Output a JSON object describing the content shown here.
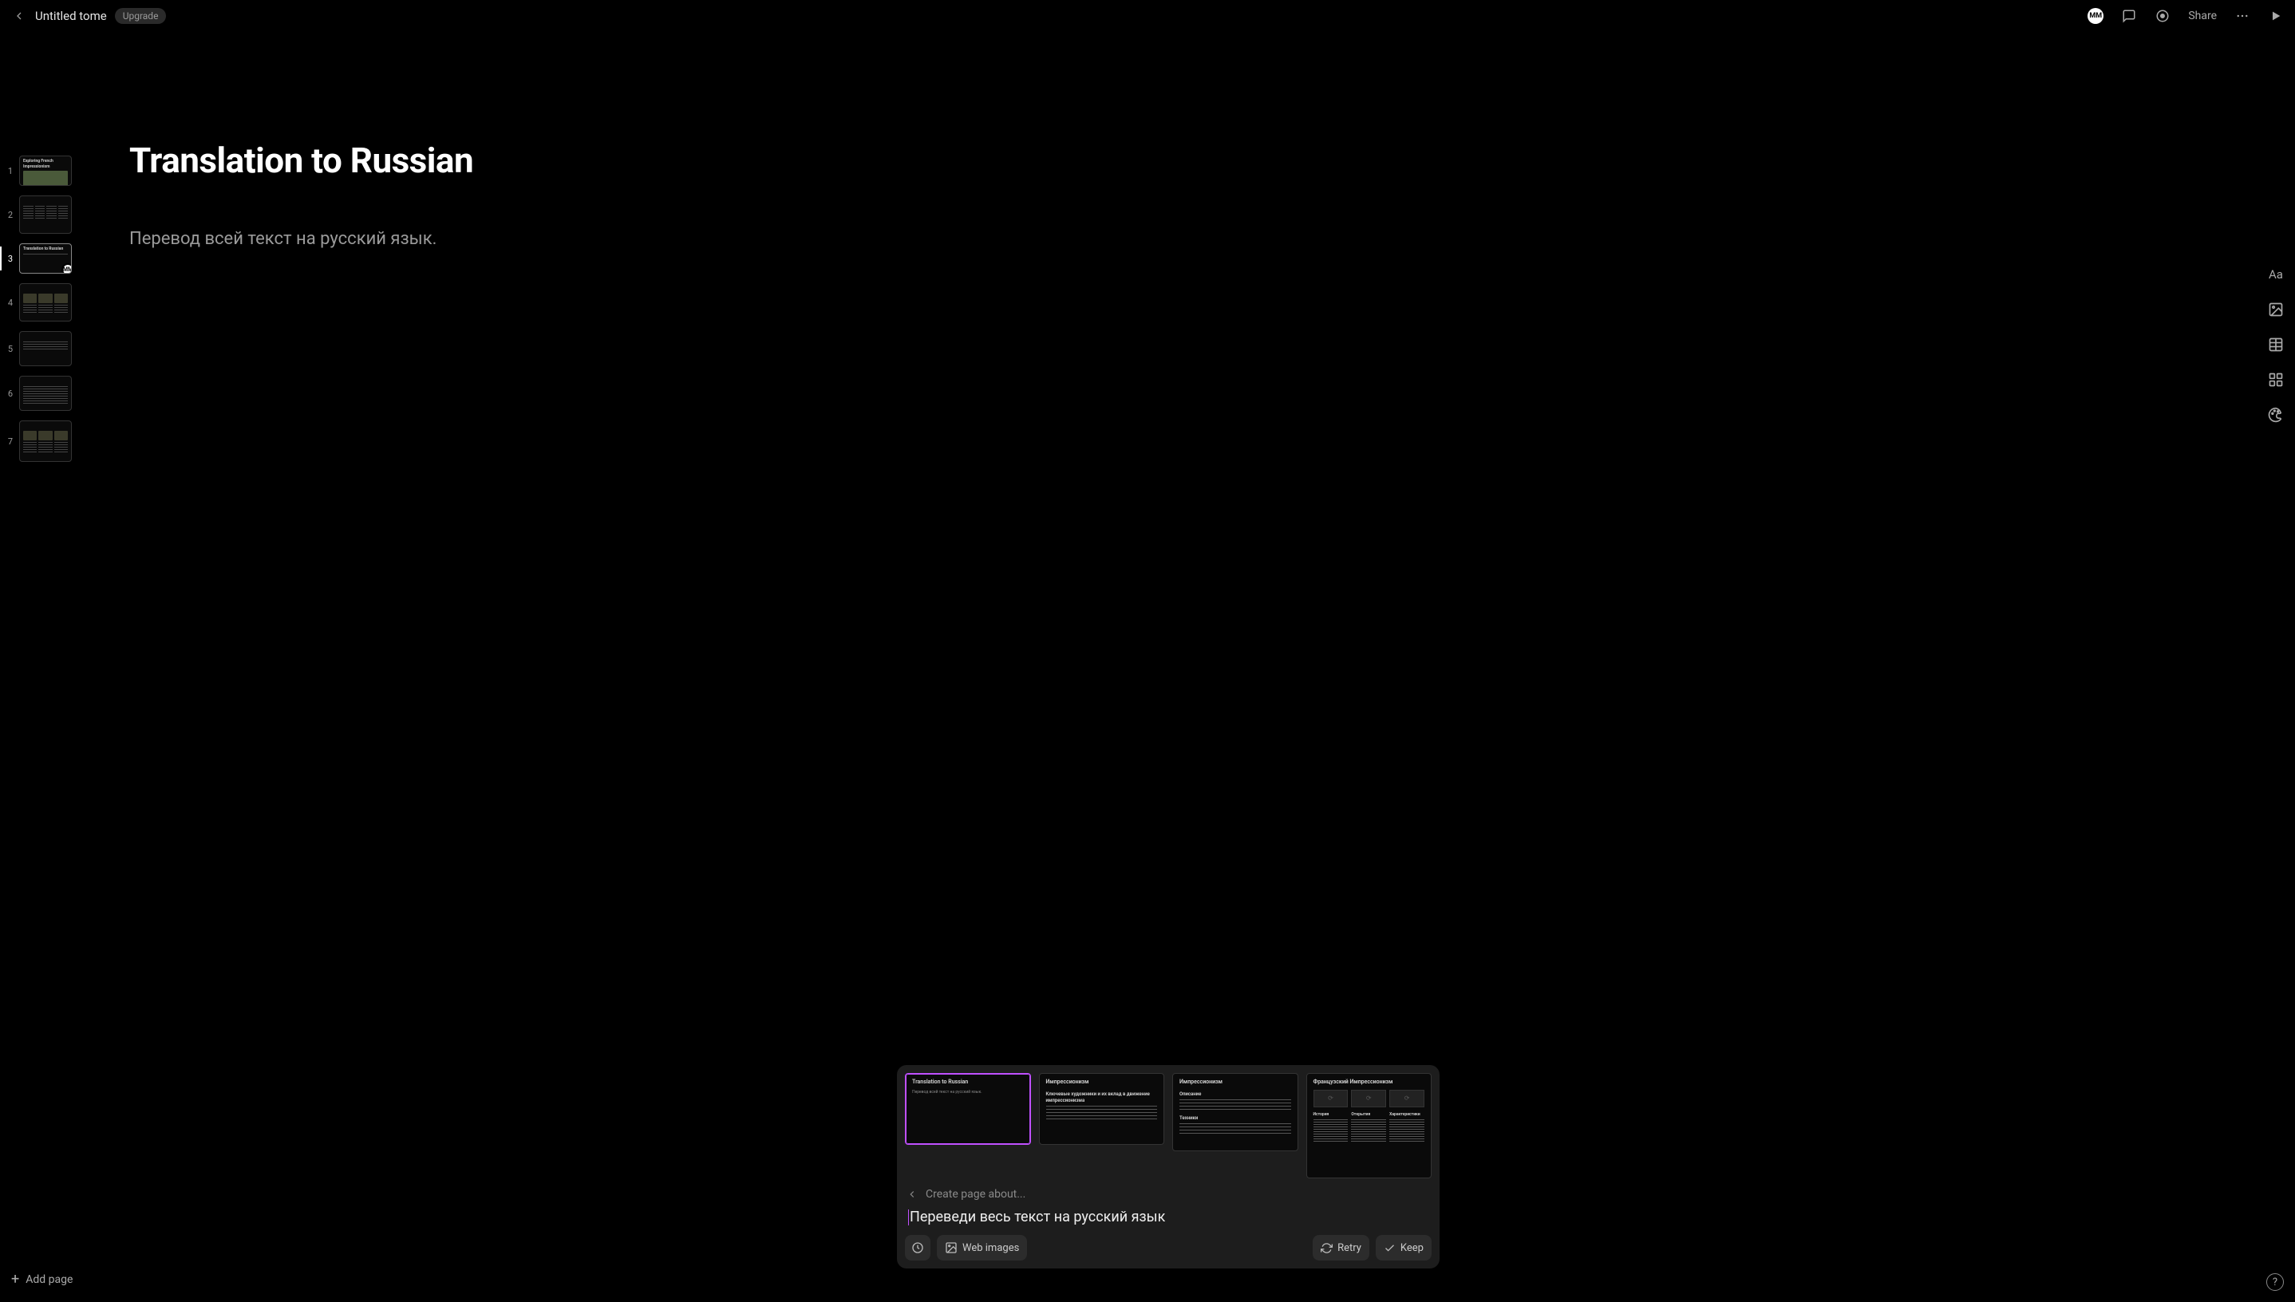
{
  "header": {
    "title": "Untitled tome",
    "upgrade": "Upgrade",
    "share": "Share",
    "avatar_initials": "MM"
  },
  "sidebar": {
    "thumbs": [
      {
        "num": "1",
        "title": "Exploring French Impressionism",
        "kind": "image"
      },
      {
        "num": "2",
        "title": "",
        "kind": "columns"
      },
      {
        "num": "3",
        "title": "Translation to Russian",
        "kind": "text",
        "selected": true,
        "indicator": "MM"
      },
      {
        "num": "4",
        "title": "",
        "kind": "images-cols"
      },
      {
        "num": "5",
        "title": "",
        "kind": "lines"
      },
      {
        "num": "6",
        "title": "",
        "kind": "paragraph"
      },
      {
        "num": "7",
        "title": "",
        "kind": "images-cols"
      }
    ],
    "add_page": "Add page"
  },
  "slide": {
    "title": "Translation to Russian",
    "body": "Перевод всей текст на русский язык."
  },
  "popup": {
    "breadcrumb": "Create page about...",
    "prompt": "Переведи весь текст на русский язык",
    "chips": {
      "history_icon": "history",
      "web_images": "Web images",
      "retry": "Retry",
      "keep": "Keep"
    },
    "options": [
      {
        "title": "Translation to Russian",
        "body": "Перевод всей текст на русский язык."
      },
      {
        "title": "Импрессионизм",
        "subtitle": "Ключевые художники и их вклад в движение импрессионизма"
      },
      {
        "title": "Импрессионизм",
        "sec1": "Описание",
        "sec2": "Техники"
      },
      {
        "title": "Французский Импрессионизм",
        "cols": [
          "История",
          "Открытия",
          "Характеристики"
        ]
      }
    ]
  },
  "tool_icons": [
    "text",
    "image",
    "table",
    "shapes",
    "theme"
  ]
}
